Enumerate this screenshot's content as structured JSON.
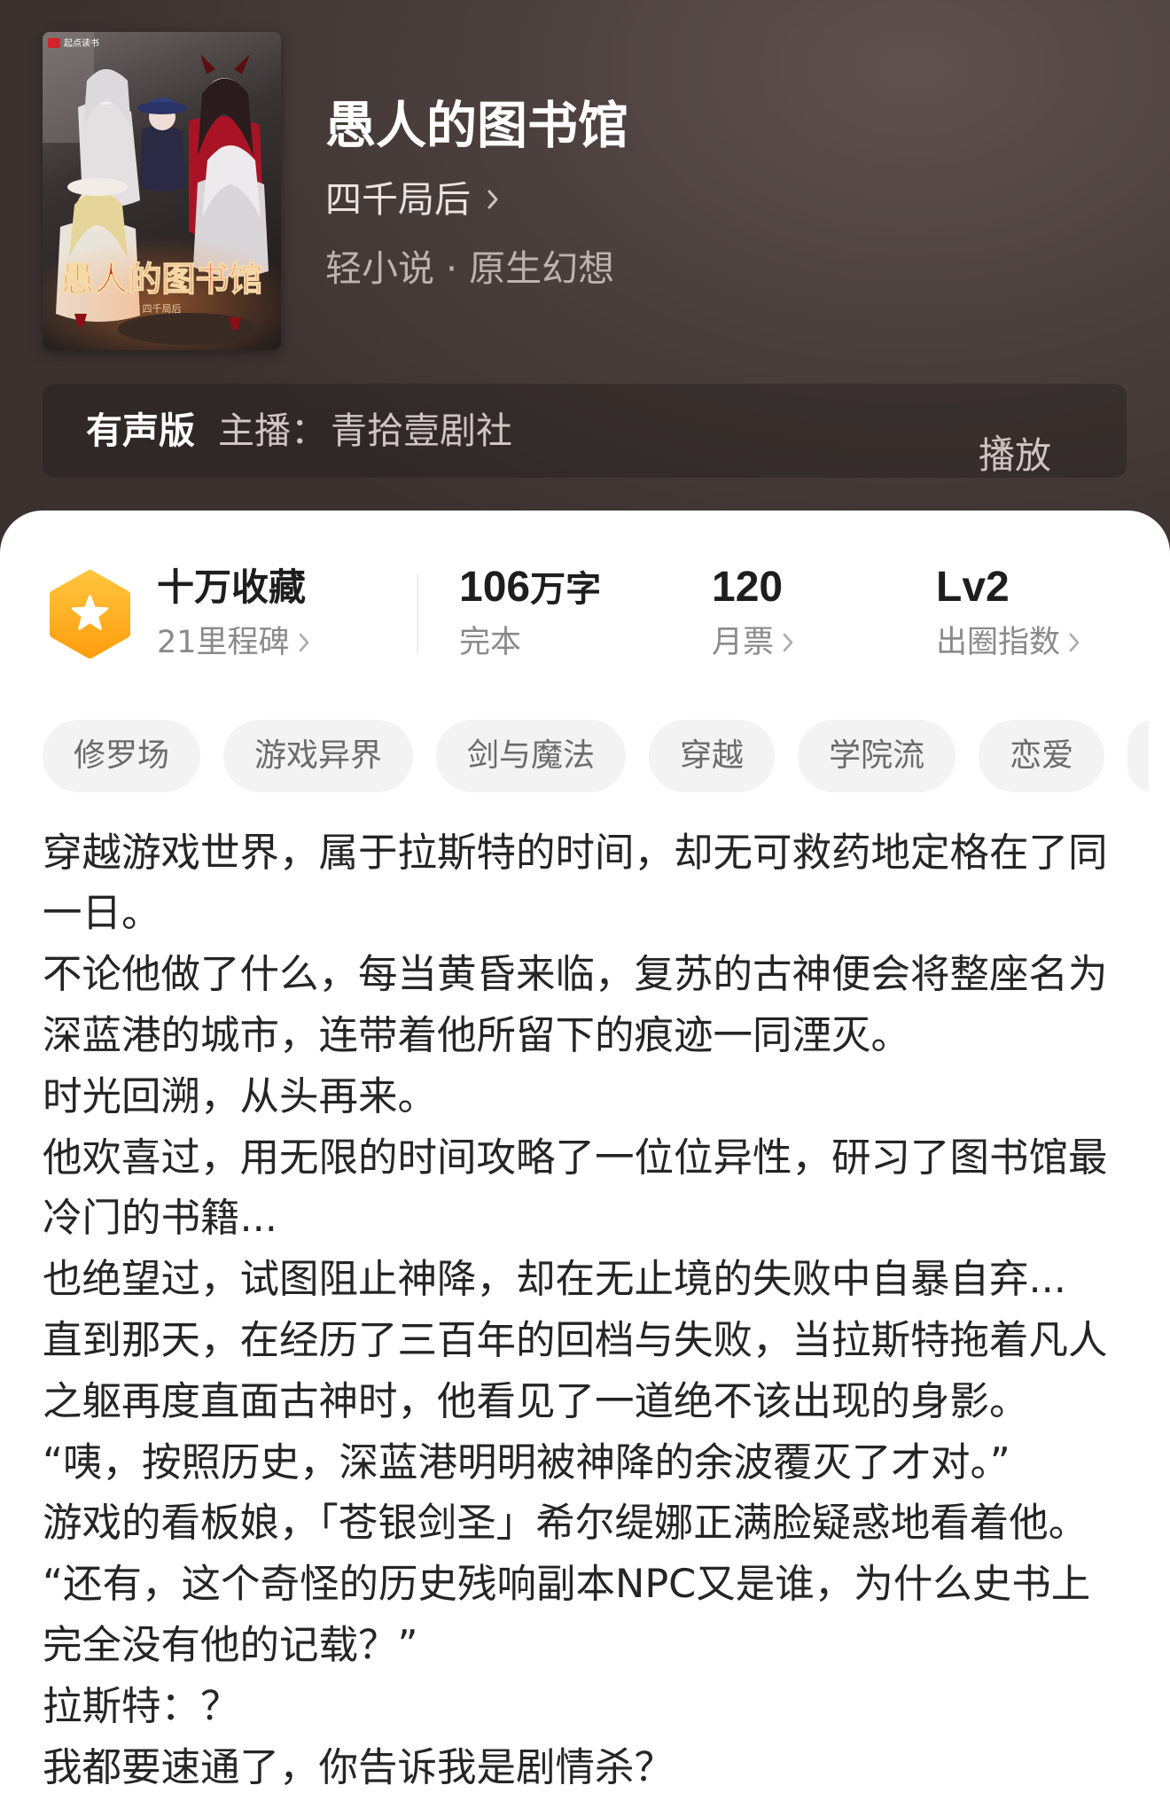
{
  "cover": {
    "badge": "起点读书",
    "title_art": "愚人的图书馆",
    "author_art": "四千局后"
  },
  "book": {
    "title": "愚人的图书馆",
    "author": "四千局后",
    "category": "轻小说 · 原生幻想"
  },
  "audio": {
    "label": "有声版",
    "host_label": "主播：",
    "host": "青拾壹剧社",
    "play_label": "播放"
  },
  "stats": {
    "favorites": {
      "value": "十万收藏",
      "sub": "21里程碑"
    },
    "words": {
      "value_num": "106",
      "value_unit": "万字",
      "sub": "完本"
    },
    "tickets": {
      "value": "120",
      "sub": "月票"
    },
    "index": {
      "value": "Lv2",
      "sub": "出圈指数"
    }
  },
  "tags": [
    "修罗场",
    "游戏异界",
    "剑与魔法",
    "穿越",
    "学院流",
    "恋爱"
  ],
  "description": {
    "lines": [
      "穿越游戏世界，属于拉斯特的时间，却无可救药地定格在了同",
      "一日。",
      "不论他做了什么，每当黄昏来临，复苏的古神便会将整座名为",
      "深蓝港的城市，连带着他所留下的痕迹一同湮灭。",
      "时光回溯，从头再来。",
      "他欢喜过，用无限的时间攻略了一位位异性，研习了图书馆最",
      "冷门的书籍...",
      "也绝望过，试图阻止神降，却在无止境的失败中自暴自弃...",
      "直到那天，在经历了三百年的回档与失败，当拉斯特拖着凡人",
      "之躯再度直面古神时，他看见了一道绝不该出现的身影。",
      "“咦，按照历史，深蓝港明明被神降的余波覆灭了才对。”",
      "游戏的看板娘，「苍银剑圣」希尔缇娜正满脸疑惑地看着他。",
      "“还有，这个奇怪的历史残响副本NPC又是谁，为什么史书上",
      "完全没有他的记载？”",
      "拉斯特：？",
      "我都要速通了，你告诉我是剧情杀？"
    ]
  },
  "colors": {
    "header_bg": "#4d413f",
    "accent_orange": "#ffad1f",
    "tag_bg": "#f3f3f3",
    "text_primary": "#252525",
    "text_secondary": "#8a8a8a"
  },
  "icons": {
    "milestone_badge": "star-hexagon-icon",
    "chevron": "chevron-right-icon"
  }
}
